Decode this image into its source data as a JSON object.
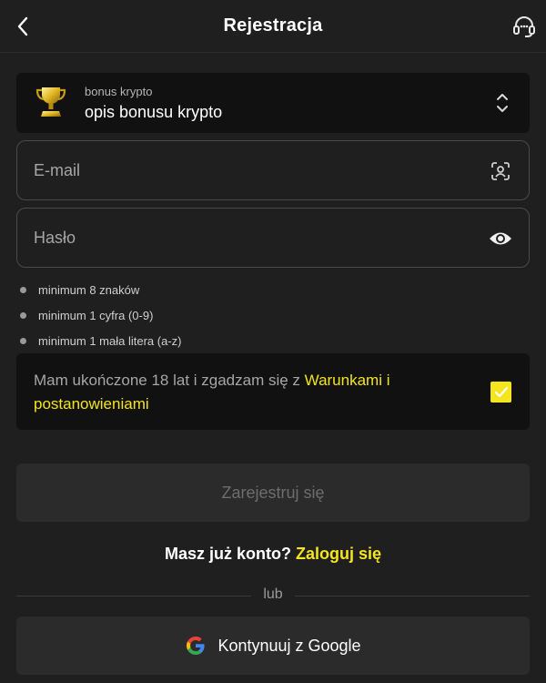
{
  "header": {
    "title": "Rejestracja",
    "back_icon": "chevron-left-icon",
    "support_icon": "headset-icon"
  },
  "bonus": {
    "label": "bonus krypto",
    "value": "opis bonusu krypto",
    "icon": "trophy-icon"
  },
  "email": {
    "placeholder": "E-mail",
    "value": "",
    "icon": "contact-card-icon"
  },
  "password": {
    "placeholder": "Hasło",
    "value": "",
    "icon": "eye-icon"
  },
  "password_rules": [
    "minimum 8 znaków",
    "minimum 1 cyfra (0-9)",
    "minimum 1 mała litera (a-z)"
  ],
  "consent": {
    "text": "Mam ukończone 18 lat i zgadzam się z ",
    "link": "Warunkami i postanowieniami",
    "checked": true
  },
  "register_button": "Zarejestruj się",
  "login": {
    "question": "Masz już konto? ",
    "link": "Zaloguj się"
  },
  "divider": "lub",
  "google_button": "Kontynuuj z Google",
  "colors": {
    "background": "#1f1f1f",
    "panel": "#111111",
    "accent": "#f4e51c",
    "button": "#2b2b2b"
  }
}
